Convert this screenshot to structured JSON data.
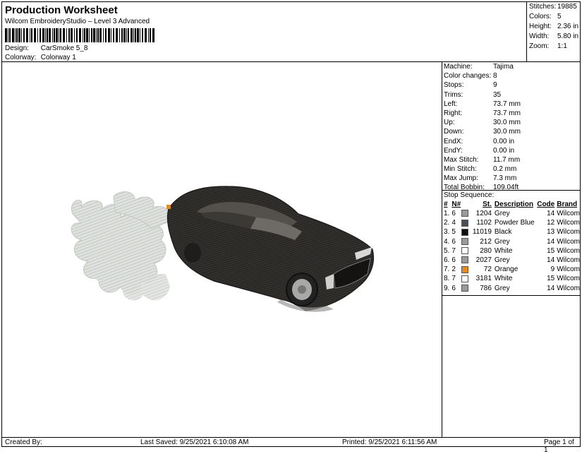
{
  "header": {
    "title": "Production Worksheet",
    "subtitle": "Wilcom EmbroideryStudio – Level 3 Advanced",
    "design_label": "Design:",
    "design_value": "CarSmoke 5_8",
    "colorway_label": "Colorway:",
    "colorway_value": "Colorway 1",
    "stats": [
      {
        "k": "Stitches:",
        "v": "19885"
      },
      {
        "k": "Colors:",
        "v": "5"
      },
      {
        "k": "Height:",
        "v": "2.36 in"
      },
      {
        "k": "Width:",
        "v": "5.80 in"
      },
      {
        "k": "Zoom:",
        "v": "1:1"
      }
    ]
  },
  "info": [
    {
      "k": "Machine:",
      "v": "Tajima"
    },
    {
      "k": "Color changes:",
      "v": "8"
    },
    {
      "k": "Stops:",
      "v": "9"
    },
    {
      "k": "Trims:",
      "v": "35"
    },
    {
      "k": "Left:",
      "v": "73.7 mm"
    },
    {
      "k": "Right:",
      "v": "73.7 mm"
    },
    {
      "k": "Up:",
      "v": "30.0 mm"
    },
    {
      "k": "Down:",
      "v": "30.0 mm"
    },
    {
      "k": "EndX:",
      "v": "0.00 in"
    },
    {
      "k": "EndY:",
      "v": "0.00 in"
    },
    {
      "k": "Max Stitch:",
      "v": "11.7 mm"
    },
    {
      "k": "Min Stitch:",
      "v": "0.2 mm"
    },
    {
      "k": "Max Jump:",
      "v": "7.3 mm"
    },
    {
      "k": "Total Bobbin:",
      "v": "109.04ft"
    }
  ],
  "stop_sequence": {
    "label": "Stop Sequence:",
    "headers": {
      "num": "#",
      "n": "N#",
      "st": "St.",
      "desc": "Description",
      "code": "Code",
      "brand": "Brand"
    },
    "rows": [
      {
        "num": "1.",
        "n": "6",
        "color": "#9a9a9a",
        "st": "1204",
        "desc": "Grey",
        "code": "14",
        "brand": "Wilcom"
      },
      {
        "num": "2.",
        "n": "4",
        "color": "#4a4f57",
        "st": "1102",
        "desc": "Powder Blue",
        "code": "12",
        "brand": "Wilcom"
      },
      {
        "num": "3.",
        "n": "5",
        "color": "#111111",
        "st": "11019",
        "desc": "Black",
        "code": "13",
        "brand": "Wilcom"
      },
      {
        "num": "4.",
        "n": "6",
        "color": "#9a9a9a",
        "st": "212",
        "desc": "Grey",
        "code": "14",
        "brand": "Wilcom"
      },
      {
        "num": "5.",
        "n": "7",
        "color": "#ffffff",
        "st": "280",
        "desc": "White",
        "code": "15",
        "brand": "Wilcom"
      },
      {
        "num": "6.",
        "n": "6",
        "color": "#9a9a9a",
        "st": "2027",
        "desc": "Grey",
        "code": "14",
        "brand": "Wilcom"
      },
      {
        "num": "7.",
        "n": "2",
        "color": "#e8891c",
        "st": "72",
        "desc": "Orange",
        "code": "9",
        "brand": "Wilcom"
      },
      {
        "num": "8.",
        "n": "7",
        "color": "#ffffff",
        "st": "3181",
        "desc": "White",
        "code": "15",
        "brand": "Wilcom"
      },
      {
        "num": "9.",
        "n": "6",
        "color": "#9a9a9a",
        "st": "786",
        "desc": "Grey",
        "code": "14",
        "brand": "Wilcom"
      }
    ]
  },
  "footer": {
    "created_by": "Created By:",
    "last_saved": "Last Saved: 9/25/2021 6:10:08 AM",
    "printed": "Printed: 9/25/2021 6:11:56 AM",
    "page": "Page 1 of 1"
  }
}
